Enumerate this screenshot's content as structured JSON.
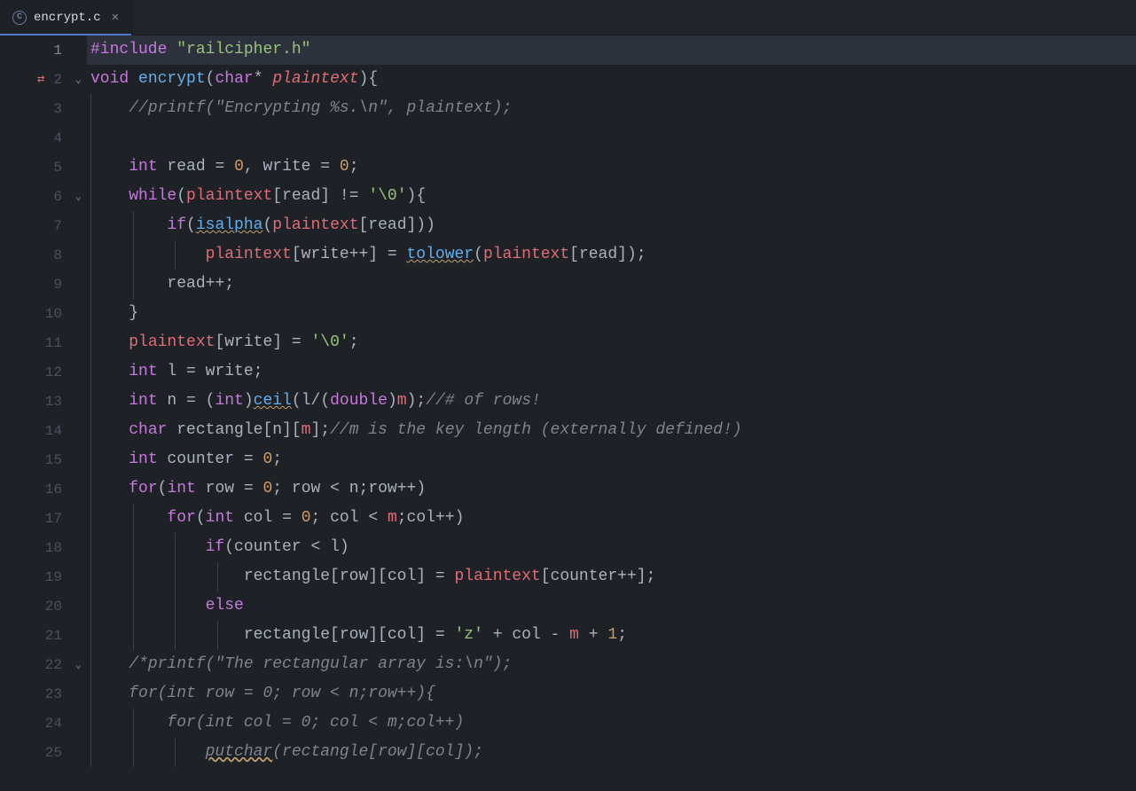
{
  "tab": {
    "filename": "encrypt.c",
    "icon_letter": "C"
  },
  "gutter": {
    "lines": 25,
    "git_marker_line": 2,
    "fold_lines": [
      2,
      6,
      22
    ],
    "current_line": 1
  },
  "code": {
    "language": "c",
    "lines": [
      {
        "n": 1,
        "hl": true,
        "tokens": [
          [
            "keyword",
            "#include"
          ],
          [
            "punct",
            " "
          ],
          [
            "string",
            "\"railcipher.h\""
          ]
        ]
      },
      {
        "n": 2,
        "tokens": [
          [
            "type",
            "void"
          ],
          [
            "ident",
            " "
          ],
          [
            "funcdef",
            "encrypt"
          ],
          [
            "punct",
            "("
          ],
          [
            "type",
            "char"
          ],
          [
            "op",
            "*"
          ],
          [
            "punct",
            " "
          ],
          [
            "param",
            "plaintext"
          ],
          [
            "punct",
            "){"
          ]
        ]
      },
      {
        "n": 3,
        "indent": 1,
        "tokens": [
          [
            "comment",
            "//printf(\"Encrypting %s.\\n\", plaintext);"
          ]
        ]
      },
      {
        "n": 4,
        "indent": 1,
        "tokens": []
      },
      {
        "n": 5,
        "indent": 1,
        "tokens": [
          [
            "type",
            "int"
          ],
          [
            "ident",
            " read "
          ],
          [
            "op",
            "="
          ],
          [
            "ident",
            " "
          ],
          [
            "number",
            "0"
          ],
          [
            "punct",
            ", write "
          ],
          [
            "op",
            "="
          ],
          [
            "ident",
            " "
          ],
          [
            "number",
            "0"
          ],
          [
            "punct",
            ";"
          ]
        ]
      },
      {
        "n": 6,
        "indent": 1,
        "tokens": [
          [
            "keyword",
            "while"
          ],
          [
            "punct",
            "("
          ],
          [
            "var",
            "plaintext"
          ],
          [
            "punct",
            "[read] "
          ],
          [
            "op",
            "!="
          ],
          [
            "punct",
            " "
          ],
          [
            "string",
            "'\\0'"
          ],
          [
            "punct",
            "){"
          ]
        ]
      },
      {
        "n": 7,
        "indent": 2,
        "tokens": [
          [
            "keyword",
            "if"
          ],
          [
            "punct",
            "("
          ],
          [
            "func-warn",
            "isalpha"
          ],
          [
            "punct",
            "("
          ],
          [
            "var",
            "plaintext"
          ],
          [
            "punct",
            "[read]))"
          ]
        ]
      },
      {
        "n": 8,
        "indent": 3,
        "tokens": [
          [
            "var",
            "plaintext"
          ],
          [
            "punct",
            "[write"
          ],
          [
            "op",
            "++"
          ],
          [
            "punct",
            "] "
          ],
          [
            "op",
            "="
          ],
          [
            "punct",
            " "
          ],
          [
            "func-warn",
            "tolower"
          ],
          [
            "punct",
            "("
          ],
          [
            "var",
            "plaintext"
          ],
          [
            "punct",
            "[read]);"
          ]
        ]
      },
      {
        "n": 9,
        "indent": 2,
        "tokens": [
          [
            "ident",
            "read"
          ],
          [
            "op",
            "++"
          ],
          [
            "punct",
            ";"
          ]
        ]
      },
      {
        "n": 10,
        "indent": 1,
        "tokens": [
          [
            "punct",
            "}"
          ]
        ]
      },
      {
        "n": 11,
        "indent": 1,
        "tokens": [
          [
            "var",
            "plaintext"
          ],
          [
            "punct",
            "[write] "
          ],
          [
            "op",
            "="
          ],
          [
            "punct",
            " "
          ],
          [
            "string",
            "'\\0'"
          ],
          [
            "punct",
            ";"
          ]
        ]
      },
      {
        "n": 12,
        "indent": 1,
        "tokens": [
          [
            "type",
            "int"
          ],
          [
            "ident",
            " l "
          ],
          [
            "op",
            "="
          ],
          [
            "ident",
            " write;"
          ]
        ]
      },
      {
        "n": 13,
        "indent": 1,
        "tokens": [
          [
            "type",
            "int"
          ],
          [
            "ident",
            " n "
          ],
          [
            "op",
            "="
          ],
          [
            "punct",
            " ("
          ],
          [
            "type",
            "int"
          ],
          [
            "punct",
            ")"
          ],
          [
            "func-warn",
            "ceil"
          ],
          [
            "punct",
            "(l"
          ],
          [
            "op",
            "/"
          ],
          [
            "punct",
            "("
          ],
          [
            "type",
            "double"
          ],
          [
            "punct",
            ")"
          ],
          [
            "var",
            "m"
          ],
          [
            "punct",
            ");"
          ],
          [
            "comment",
            "//# of rows!"
          ]
        ]
      },
      {
        "n": 14,
        "indent": 1,
        "tokens": [
          [
            "type",
            "char"
          ],
          [
            "ident",
            " rectangle[n]["
          ],
          [
            "var",
            "m"
          ],
          [
            "punct",
            "];"
          ],
          [
            "comment",
            "//m is the key length (externally defined!)"
          ]
        ]
      },
      {
        "n": 15,
        "indent": 1,
        "tokens": [
          [
            "type",
            "int"
          ],
          [
            "ident",
            " counter "
          ],
          [
            "op",
            "="
          ],
          [
            "ident",
            " "
          ],
          [
            "number",
            "0"
          ],
          [
            "punct",
            ";"
          ]
        ]
      },
      {
        "n": 16,
        "indent": 1,
        "tokens": [
          [
            "keyword",
            "for"
          ],
          [
            "punct",
            "("
          ],
          [
            "type",
            "int"
          ],
          [
            "ident",
            " row "
          ],
          [
            "op",
            "="
          ],
          [
            "ident",
            " "
          ],
          [
            "number",
            "0"
          ],
          [
            "punct",
            "; row "
          ],
          [
            "op",
            "<"
          ],
          [
            "ident",
            " n;row"
          ],
          [
            "op",
            "++"
          ],
          [
            "punct",
            ")"
          ]
        ]
      },
      {
        "n": 17,
        "indent": 2,
        "tokens": [
          [
            "keyword",
            "for"
          ],
          [
            "punct",
            "("
          ],
          [
            "type",
            "int"
          ],
          [
            "ident",
            " col "
          ],
          [
            "op",
            "="
          ],
          [
            "ident",
            " "
          ],
          [
            "number",
            "0"
          ],
          [
            "punct",
            "; col "
          ],
          [
            "op",
            "<"
          ],
          [
            "ident",
            " "
          ],
          [
            "var",
            "m"
          ],
          [
            "punct",
            ";col"
          ],
          [
            "op",
            "++"
          ],
          [
            "punct",
            ")"
          ]
        ]
      },
      {
        "n": 18,
        "indent": 3,
        "tokens": [
          [
            "keyword",
            "if"
          ],
          [
            "punct",
            "(counter "
          ],
          [
            "op",
            "<"
          ],
          [
            "ident",
            " l)"
          ]
        ]
      },
      {
        "n": 19,
        "indent": 4,
        "tokens": [
          [
            "ident",
            "rectangle[row][col] "
          ],
          [
            "op",
            "="
          ],
          [
            "ident",
            " "
          ],
          [
            "var",
            "plaintext"
          ],
          [
            "punct",
            "[counter"
          ],
          [
            "op",
            "++"
          ],
          [
            "punct",
            "];"
          ]
        ]
      },
      {
        "n": 20,
        "indent": 3,
        "tokens": [
          [
            "keyword",
            "else"
          ]
        ]
      },
      {
        "n": 21,
        "indent": 4,
        "tokens": [
          [
            "ident",
            "rectangle[row][col] "
          ],
          [
            "op",
            "="
          ],
          [
            "ident",
            " "
          ],
          [
            "string",
            "'z'"
          ],
          [
            "ident",
            " "
          ],
          [
            "op",
            "+"
          ],
          [
            "ident",
            " col "
          ],
          [
            "op",
            "-"
          ],
          [
            "ident",
            " "
          ],
          [
            "var",
            "m"
          ],
          [
            "ident",
            " "
          ],
          [
            "op",
            "+"
          ],
          [
            "ident",
            " "
          ],
          [
            "number",
            "1"
          ],
          [
            "punct",
            ";"
          ]
        ]
      },
      {
        "n": 22,
        "indent": 1,
        "tokens": [
          [
            "comment",
            "/*printf(\"The rectangular array is:\\n\");"
          ]
        ]
      },
      {
        "n": 23,
        "indent": 1,
        "tokens": [
          [
            "comment",
            "for(int row = 0; row < n;row++){"
          ]
        ]
      },
      {
        "n": 24,
        "indent": 2,
        "tokens": [
          [
            "comment",
            "for(int col = 0; col < m;col++)"
          ]
        ]
      },
      {
        "n": 25,
        "indent": 3,
        "tokens": [
          [
            "comment-pre",
            "putchar"
          ],
          [
            "comment",
            "(rectangle[row][col]);"
          ]
        ]
      }
    ]
  }
}
